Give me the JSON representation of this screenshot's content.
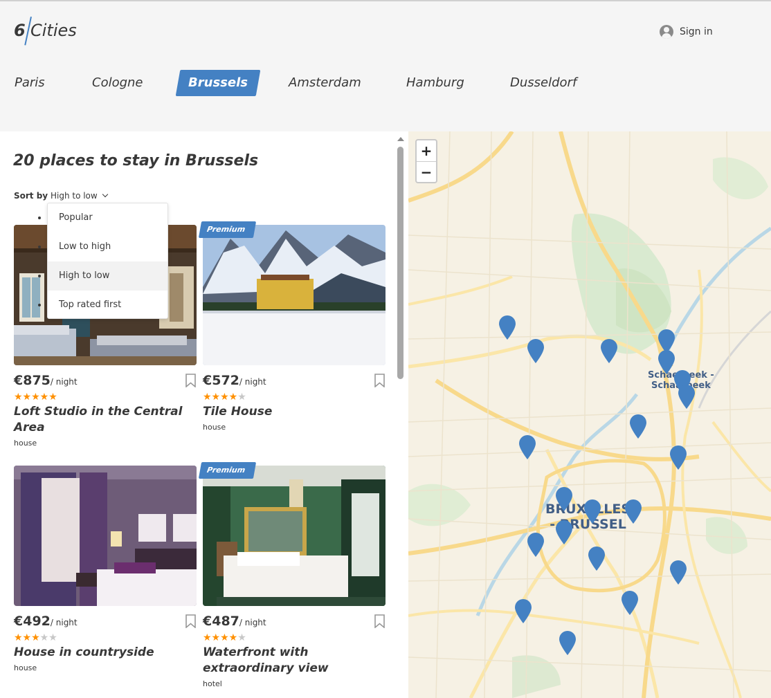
{
  "header": {
    "logo_number": "6",
    "logo_word": "Cities",
    "signin_label": "Sign in"
  },
  "cities": [
    {
      "label": "Paris",
      "active": false
    },
    {
      "label": "Cologne",
      "active": false
    },
    {
      "label": "Brussels",
      "active": true
    },
    {
      "label": "Amsterdam",
      "active": false
    },
    {
      "label": "Hamburg",
      "active": false
    },
    {
      "label": "Dusseldorf",
      "active": false
    }
  ],
  "main": {
    "places_title": "20 places to stay in Brussels",
    "sort_label": "Sort by",
    "sort_value": "High to low",
    "sort_options": [
      "Popular",
      "Low to high",
      "High to low",
      "Top rated first"
    ],
    "sort_selected_index": 2
  },
  "offers": [
    {
      "price": "€875",
      "per": "/ night",
      "rating_stars": 5,
      "name": "Loft Studio in the Central Area",
      "type": "house",
      "premium": false
    },
    {
      "price": "€572",
      "per": "/ night",
      "rating_stars": 4,
      "name": "Tile House",
      "type": "house",
      "premium": true,
      "premium_label": "Premium"
    },
    {
      "price": "€492",
      "per": "/ night",
      "rating_stars": 3,
      "name": "House in countryside",
      "type": "house",
      "premium": false
    },
    {
      "price": "€487",
      "per": "/ night",
      "rating_stars": 4,
      "name": "Waterfront with extraordinary view",
      "type": "hotel",
      "premium": true,
      "premium_label": "Premium"
    }
  ],
  "map": {
    "zoom_in": "+",
    "zoom_out": "−",
    "label_center_1": "BRUXELLES",
    "label_center_2": "- BRUSSEL",
    "label_east_1": "Schaerbeek -",
    "label_east_2": "Schaarbeek",
    "pin_count": 20
  },
  "colors": {
    "accent": "#4481c3",
    "star": "#ff9000",
    "star_empty": "#c7c7c7",
    "header_bg": "#f5f5f5"
  }
}
